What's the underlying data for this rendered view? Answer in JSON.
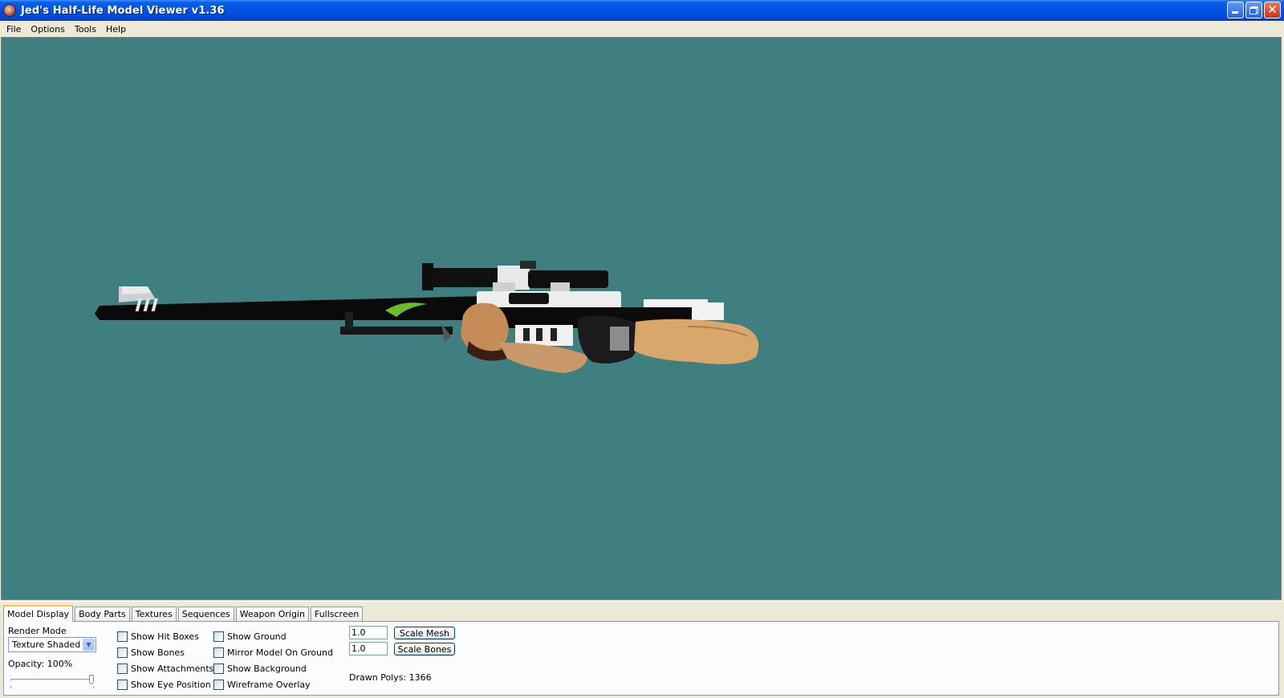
{
  "window": {
    "title": "Jed's Half-Life Model Viewer v1.36",
    "accent_color": "#0054e3"
  },
  "menu": {
    "items": [
      "File",
      "Options",
      "Tools",
      "Help"
    ]
  },
  "viewport": {
    "background_color": "#3f7f7f"
  },
  "tabs": {
    "items": [
      "Model Display",
      "Body Parts",
      "Textures",
      "Sequences",
      "Weapon Origin",
      "Fullscreen"
    ],
    "active": "Model Display"
  },
  "model_display": {
    "render_mode_label": "Render Mode",
    "render_mode_value": "Texture Shaded",
    "opacity_label": "Opacity: 100%",
    "opacity_value": 1.0,
    "checkboxes_col1": [
      {
        "label": "Show Hit Boxes",
        "checked": false
      },
      {
        "label": "Show Bones",
        "checked": false
      },
      {
        "label": "Show Attachments",
        "checked": false
      },
      {
        "label": "Show Eye Position",
        "checked": false
      }
    ],
    "checkboxes_col2": [
      {
        "label": "Show Ground",
        "checked": false
      },
      {
        "label": "Mirror Model On Ground",
        "checked": false
      },
      {
        "label": "Show Background",
        "checked": false
      },
      {
        "label": "Wireframe Overlay",
        "checked": false
      }
    ],
    "scale_mesh_value": "1.0",
    "scale_mesh_button": "Scale Mesh",
    "scale_bones_value": "1.0",
    "scale_bones_button": "Scale Bones",
    "drawn_polys": "Drawn Polys: 1366"
  }
}
